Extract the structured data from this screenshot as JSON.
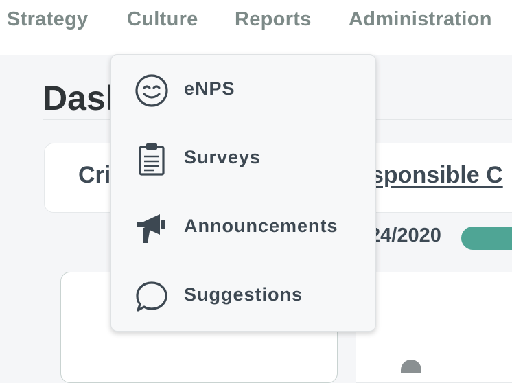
{
  "nav": {
    "items": [
      {
        "label": "Strategy"
      },
      {
        "label": "Culture"
      },
      {
        "label": "Reports"
      },
      {
        "label": "Administration"
      }
    ]
  },
  "page": {
    "title": "Dash",
    "card_left_text": "Cri",
    "card_link_text": "sponsible C",
    "date_text": "24/2020"
  },
  "dropdown": {
    "items": [
      {
        "label": "eNPS",
        "icon": "smiley-icon"
      },
      {
        "label": "Surveys",
        "icon": "clipboard-icon"
      },
      {
        "label": "Announcements",
        "icon": "megaphone-icon"
      },
      {
        "label": "Suggestions",
        "icon": "speech-bubble-icon"
      }
    ]
  },
  "colors": {
    "accent": "#4fa595",
    "nav_text": "#7d8a88",
    "menu_text": "#3d4852"
  }
}
